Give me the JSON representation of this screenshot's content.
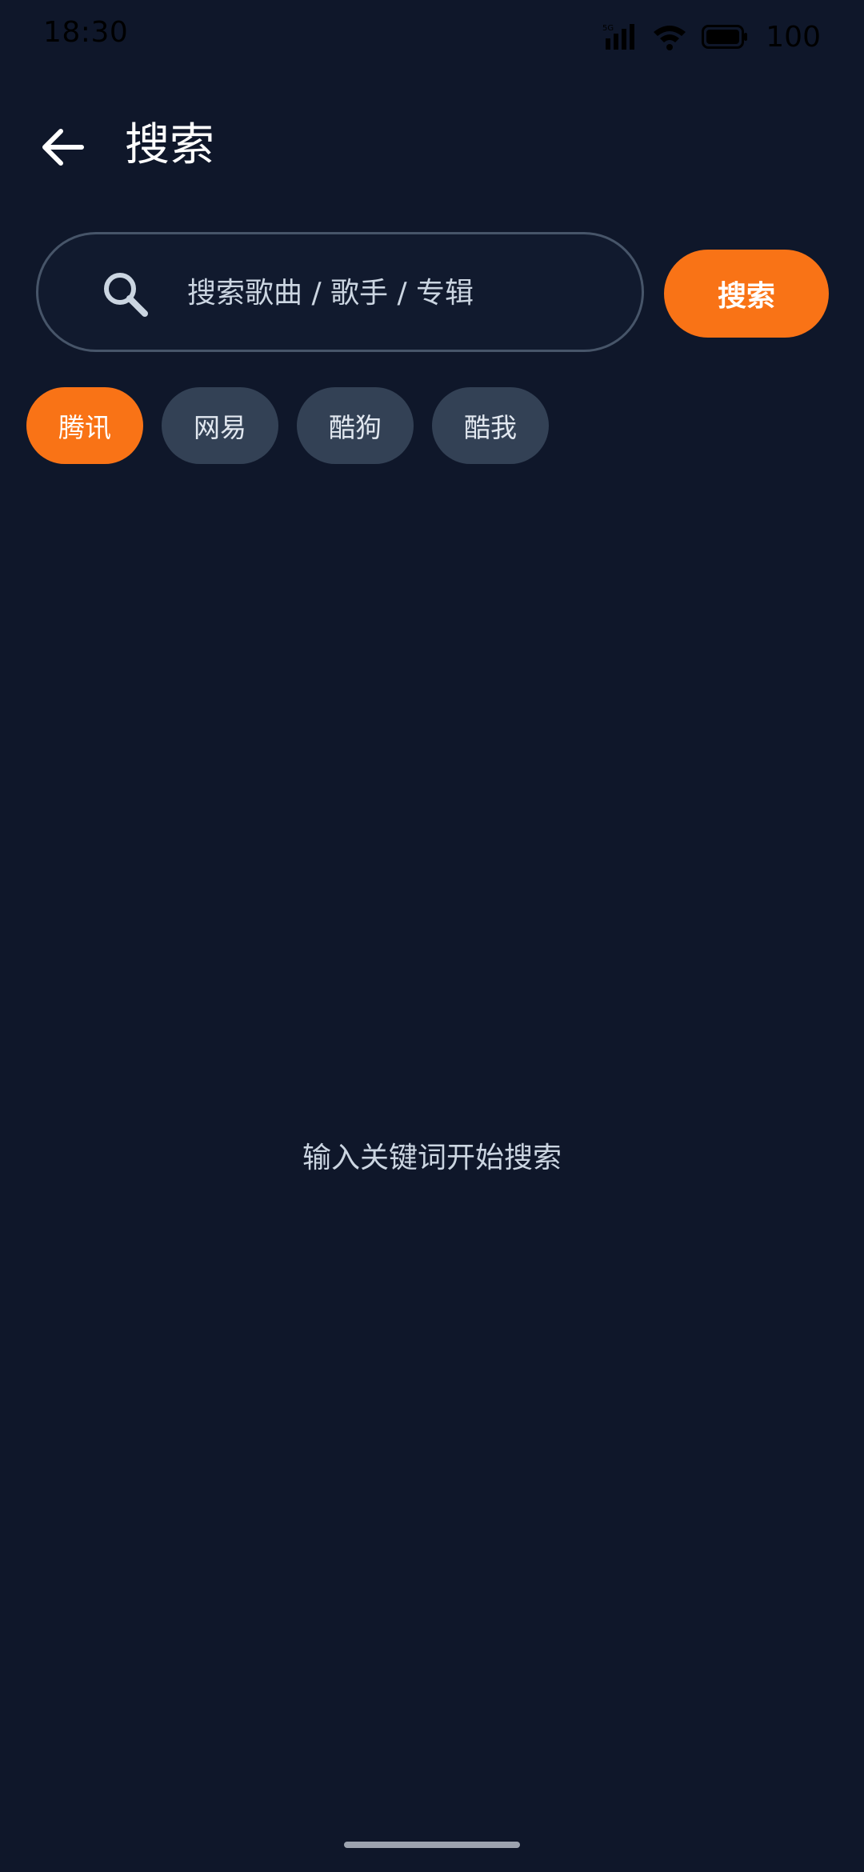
{
  "status_bar": {
    "time": "18:30",
    "battery": "100",
    "icons": [
      "signal-5g-icon",
      "wifi-icon",
      "battery-icon"
    ]
  },
  "header": {
    "title": "搜索",
    "back_icon": "arrow-left-icon"
  },
  "search": {
    "placeholder": "搜索歌曲 / 歌手 / 专辑",
    "value": "",
    "button_label": "搜索",
    "icon": "search-icon"
  },
  "sources": [
    {
      "label": "腾讯",
      "active": true
    },
    {
      "label": "网易",
      "active": false
    },
    {
      "label": "酷狗",
      "active": false
    },
    {
      "label": "酷我",
      "active": false
    }
  ],
  "empty_state": {
    "message": "输入关键词开始搜索"
  },
  "colors": {
    "background": "#0f172a",
    "accent": "#f97316",
    "chip": "#334155",
    "search_border": "#475569"
  }
}
